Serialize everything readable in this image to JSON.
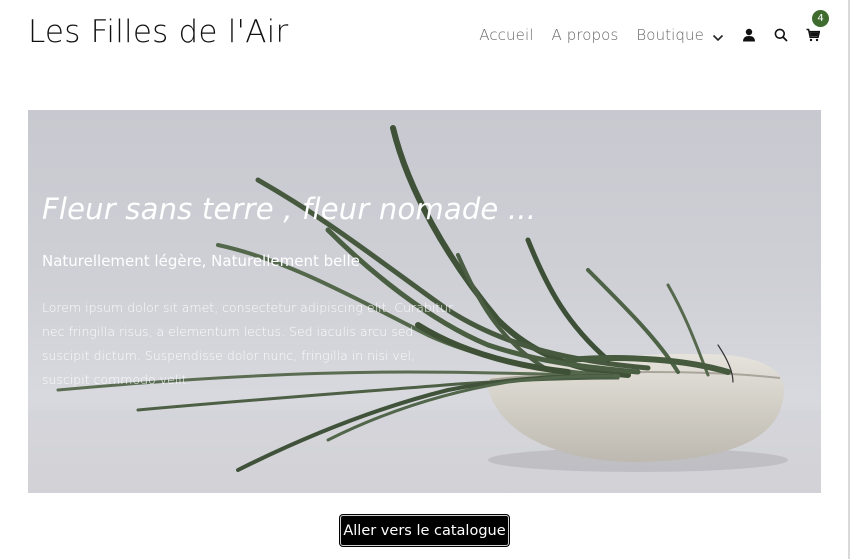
{
  "site": {
    "title": "Les Filles de l'Air"
  },
  "nav": {
    "items": [
      {
        "label": "Accueil"
      },
      {
        "label": "A propos"
      },
      {
        "label": "Boutique"
      }
    ],
    "icons": [
      "user-icon",
      "search-icon",
      "cart-icon",
      "chevron-down-icon"
    ],
    "cart_count": "4"
  },
  "hero": {
    "title": "Fleur sans terre , fleur nomade ...",
    "subtitle": "Naturellement légère, Naturellement belle",
    "text": "Lorem ipsum dolor sit amet, consectetur adipiscing elit. Curabitur nec fringilla risus, a elementum lectus. Sed iaculis arcu sed suscipit dictum. Suspendisse dolor nunc, fringilla in nisi vel, suscipit commodo velit."
  },
  "cta": {
    "label": "Aller vers le catalogue"
  },
  "colors": {
    "badge": "#3f6b2e",
    "button": "#000000",
    "nav_text": "#666666"
  }
}
